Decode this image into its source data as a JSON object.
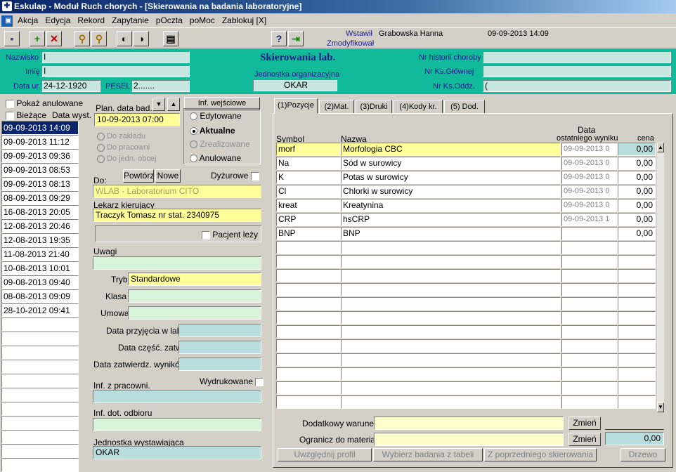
{
  "window": {
    "title": "Eskulap - Moduł Ruch chorych - [Skierowania na badania laboratoryjne]"
  },
  "menu": [
    "Akcja",
    "Edycja",
    "Rekord",
    "Zapytanie",
    "pOczta",
    "poMoc",
    "Zablokuj [X]"
  ],
  "toolbar": {
    "wstawil_label": "Wstawił",
    "wstawil_user": "Grabowska Hanna",
    "wstawil_date": "09-09-2013 14:09",
    "zmodyfikowal_label": "Zmodyfikował"
  },
  "header": {
    "title": "Skierowania lab.",
    "nazwisko_label": "Nazwisko",
    "nazwisko": "I",
    "imie_label": "Imię",
    "imie": "I",
    "data_ur_label": "Data ur.",
    "data_ur": "24-12-1920",
    "pesel_label": "PESEL",
    "pesel": "2.......",
    "jednostka_label": "Jednostka organizacyjna",
    "jednostka": "OKAR",
    "nr_hist_label": "Nr historii choroby",
    "nr_ks_gl_label": "Nr Ks.Głównej",
    "nr_ks_odd_label": "Nr Ks.Oddz.",
    "nr_ks_odd": "("
  },
  "left": {
    "pokaz_anulowane": "Pokaż anulowane",
    "biezace": "Bieżące",
    "data_wyst": "Data wyst.",
    "dates": [
      "09-09-2013 14:09",
      "09-09-2013 11:12",
      "09-09-2013 09:36",
      "09-09-2013 08:53",
      "09-09-2013 08:13",
      "08-09-2013 09:29",
      "16-08-2013 20:05",
      "12-08-2013 20:46",
      "12-08-2013 19:35",
      "11-08-2013 21:40",
      "10-08-2013 10:01",
      "09-08-2013 09:40",
      "08-08-2013 09:09",
      "28-10-2012 09:41"
    ]
  },
  "form": {
    "plan_label": "Plan. data bad.",
    "plan": "10-09-2013 07:00",
    "inf_wejsciowe": "Inf. wejściowe",
    "status": [
      "Edytowane",
      "Aktualne",
      "Zrealizowane",
      "Anulowane"
    ],
    "do_zakladu": "Do zakładu",
    "do_pracowni": "Do pracowni",
    "do_jedn": "Do jedn. obcej",
    "powtorz": "Powtórz",
    "nowe": "Nowe",
    "dyzurowe": "Dyżurowe",
    "do_label": "Do:",
    "do": "WLAB - Laboratorium CITO",
    "lekarz_label": "Lekarz kierujący",
    "lekarz": "Traczyk Tomasz nr stat. 2340975",
    "pacjent_lezy": "Pacjent leży",
    "uwagi": "Uwagi",
    "tryb_label": "Tryb",
    "tryb": "Standardowe",
    "klasa": "Klasa",
    "umowa": "Umowa",
    "data_przyjecia": "Data przyjęcia w lab.",
    "data_czesc": "Data część. zatw.",
    "data_zatw": "Data zatwierdz. wyników",
    "wydrukowane": "Wydrukowane",
    "inf_prac": "Inf. z pracowni.",
    "inf_odb": "Inf. dot. odbioru",
    "jedn_wyst": "Jednostka wystawiająca",
    "jedn_wyst_val": "OKAR"
  },
  "tabs": [
    "(1)Pozycje",
    "(2)Mat.",
    "(3)Druki",
    "(4)Kody kr.",
    "(5) Dod."
  ],
  "grid": {
    "symbol": "Symbol",
    "nazwa": "Nazwa",
    "data1": "Data",
    "data2": "ostatniego wyniku",
    "cena": "cena",
    "rows": [
      {
        "symbol": "morf",
        "nazwa": "Morfologia CBC",
        "data": "09-09-2013 0",
        "cena": "0,00"
      },
      {
        "symbol": "Na",
        "nazwa": "Sód w surowicy",
        "data": "09-09-2013 0",
        "cena": "0,00"
      },
      {
        "symbol": "K",
        "nazwa": "Potas w surowicy",
        "data": "09-09-2013 0",
        "cena": "0,00"
      },
      {
        "symbol": "Cl",
        "nazwa": "Chlorki w surowicy",
        "data": "09-09-2013 0",
        "cena": "0,00"
      },
      {
        "symbol": "kreat",
        "nazwa": "Kreatynina",
        "data": "09-09-2013 0",
        "cena": "0,00"
      },
      {
        "symbol": "CRP",
        "nazwa": "hsCRP",
        "data": "09-09-2013 1",
        "cena": "0,00"
      },
      {
        "symbol": "BNP",
        "nazwa": "BNP",
        "data": "",
        "cena": "0,00"
      }
    ]
  },
  "bottom": {
    "dodatkowy": "Dodatkowy warunek",
    "ogranicz": "Ogranicz do materiału",
    "zmien": "Zmień",
    "suma": "0,00",
    "uwzglednij": "Uwzględnij profil",
    "wybierz": "Wybierz badania z tabeli",
    "z_poprzedniego": "Z poprzedniego skierowania",
    "drzewo": "Drzewo"
  }
}
